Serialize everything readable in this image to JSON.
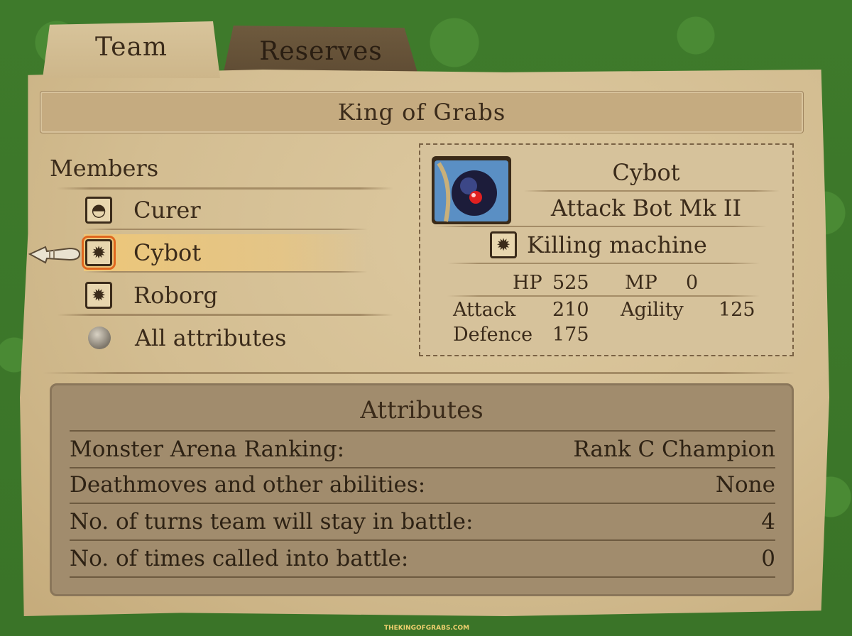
{
  "tabs": [
    {
      "label": "Team",
      "active": true
    },
    {
      "label": "Reserves",
      "active": false
    }
  ],
  "team_name": "King of Grabs",
  "members_heading": "Members",
  "members": [
    {
      "name": "Curer",
      "icon": "slime-family-icon",
      "glyph": "◓"
    },
    {
      "name": "Cybot",
      "icon": "machine-family-icon",
      "glyph": "✹",
      "selected": true
    },
    {
      "name": "Roborg",
      "icon": "machine-family-icon",
      "glyph": "✹"
    }
  ],
  "all_attributes_label": "All attributes",
  "selected_monster": {
    "name": "Cybot",
    "species": "Attack Bot Mk II",
    "family": "Killing machine",
    "family_glyph": "✹",
    "stats": {
      "hp_label": "HP",
      "hp": "525",
      "mp_label": "MP",
      "mp": "0",
      "attack_label": "Attack",
      "attack": "210",
      "agility_label": "Agility",
      "agility": "125",
      "defence_label": "Defence",
      "defence": "175"
    }
  },
  "attributes": {
    "title": "Attributes",
    "rows": [
      {
        "label": "Monster Arena Ranking:",
        "value": "Rank C Champion"
      },
      {
        "label": "Deathmoves and other abilities:",
        "value": "None"
      },
      {
        "label": "No. of turns team will stay in battle:",
        "value": "4"
      },
      {
        "label": "No. of times called into battle:",
        "value": "0"
      }
    ]
  },
  "watermark": "THEKINGOFGRABS.COM",
  "colors": {
    "accent": "#e0661e",
    "highlight": "#f0c878",
    "parchment": "#d3bd91",
    "panel": "#a18c6d"
  }
}
